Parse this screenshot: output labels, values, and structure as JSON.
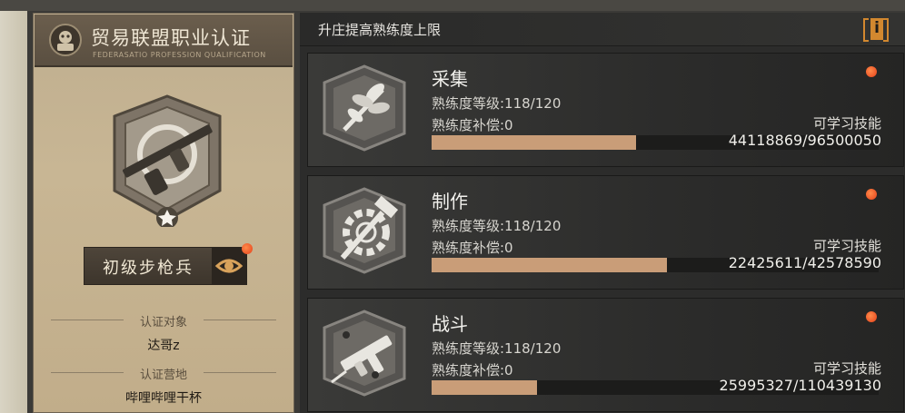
{
  "certification": {
    "title": "贸易联盟职业认证",
    "subtitle": "FEDERASATIO PROFESSION QUALIFICATION",
    "rank": "初级步枪兵",
    "target_label": "认证对象",
    "target_value": "达哥z",
    "camp_label": "认证营地",
    "camp_value": "哔哩哔哩干杯"
  },
  "panel": {
    "title": "升庄提高熟练度上限",
    "info_icon": "info-icon"
  },
  "skills": [
    {
      "name": "采集",
      "icon": "leaf-bundle-icon",
      "level_text": "熟练度等级:118/120",
      "comp_text": "熟练度补偿:0",
      "skill_label": "可学习技能",
      "progress_text": "44118869/96500050",
      "progress": 0.4572
    },
    {
      "name": "制作",
      "icon": "gear-hammer-icon",
      "level_text": "熟练度等级:118/120",
      "comp_text": "熟练度补偿:0",
      "skill_label": "可学习技能",
      "progress_text": "22425611/42578590",
      "progress": 0.5267
    },
    {
      "name": "战斗",
      "icon": "submachine-gun-icon",
      "level_text": "熟练度等级:118/120",
      "comp_text": "熟练度补偿:0",
      "skill_label": "可学习技能",
      "progress_text": "25995327/110439130",
      "progress": 0.2354
    }
  ],
  "colors": {
    "accent": "#d2882f",
    "progress_fill": "#c99d78",
    "notification": "#e5411a"
  }
}
